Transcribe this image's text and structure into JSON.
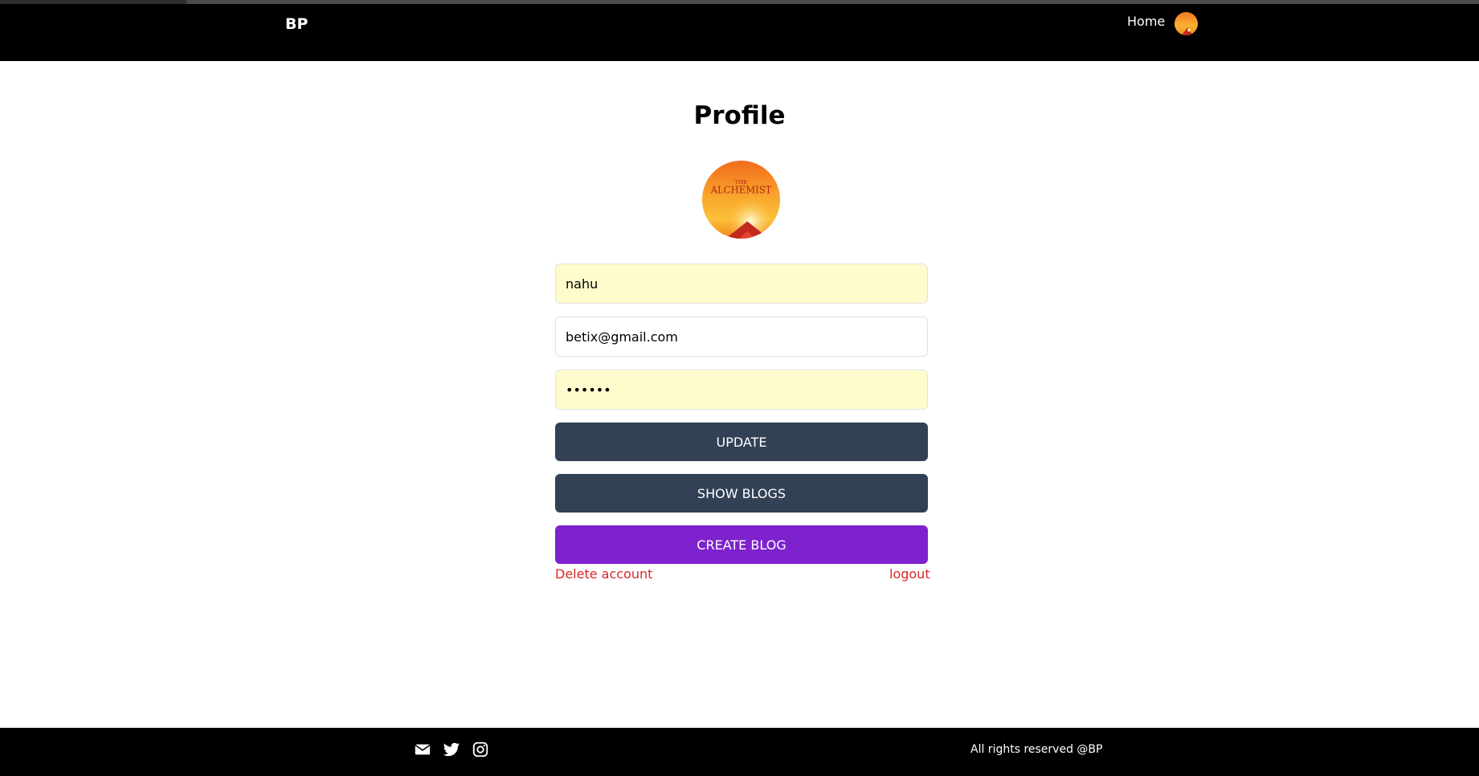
{
  "header": {
    "brand": "BP",
    "nav_home": "Home"
  },
  "profile": {
    "title": "Profile",
    "avatar_text_top": "THE",
    "avatar_text_main": "ALCHEMIST",
    "fields": {
      "username": "nahu",
      "email": "betix@gmail.com",
      "password": "123456"
    },
    "buttons": {
      "update": "UPDATE",
      "show_blogs": "SHOW BLOGS",
      "create_blog": "CREATE BLOG"
    },
    "links": {
      "delete_account": "Delete account",
      "logout": "logout"
    }
  },
  "footer": {
    "icons": [
      "envelope-icon",
      "twitter-icon",
      "instagram-icon"
    ],
    "copyright": "All rights reserved @BP"
  },
  "colors": {
    "dark_button": "#334155",
    "purple_button": "#7e22ce",
    "danger_link": "#dc2626",
    "autofill_bg": "#fefccc"
  }
}
